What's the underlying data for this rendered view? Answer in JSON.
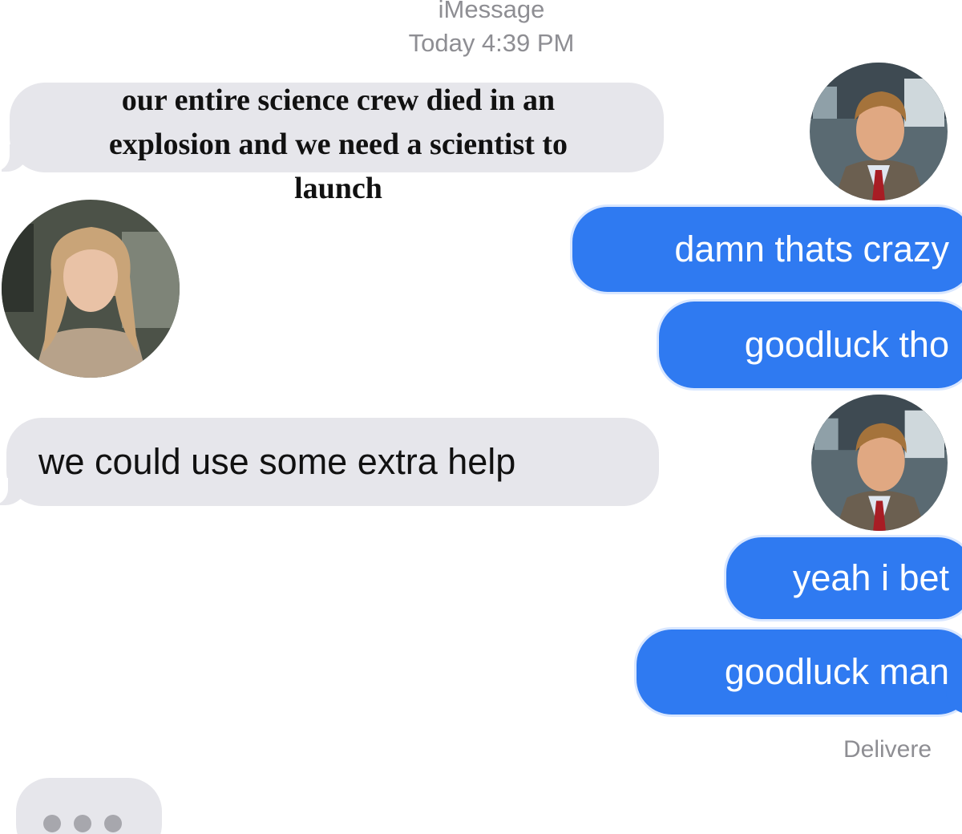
{
  "header": {
    "service": "iMessage",
    "timestamp": "Today 4:39 PM"
  },
  "messages": [
    {
      "sender": "them",
      "text": "our entire science crew died in an explosion and we need a scientist to launch"
    },
    {
      "sender": "me",
      "text": "damn thats crazy"
    },
    {
      "sender": "me",
      "text": "goodluck tho"
    },
    {
      "sender": "them",
      "text": "we could use some extra help"
    },
    {
      "sender": "me",
      "text": "yeah i bet"
    },
    {
      "sender": "me",
      "text": "goodluck man"
    }
  ],
  "status": {
    "delivered": "Delivere"
  },
  "colors": {
    "sent_bubble": "#2f7af1",
    "received_bubble": "#e6e6eb",
    "meta_text": "#8e8e93"
  },
  "icons": {
    "typing": "typing-indicator-icon",
    "avatar_her": "avatar-woman",
    "avatar_him": "avatar-man"
  }
}
